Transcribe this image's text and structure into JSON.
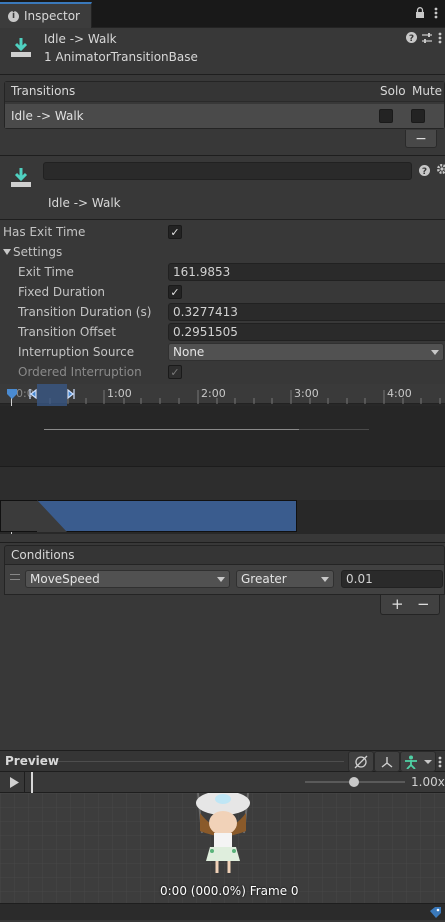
{
  "tab": {
    "label": "Inspector"
  },
  "header": {
    "title": "Idle -> Walk",
    "subtitle": "1 AnimatorTransitionBase"
  },
  "transitions_list": {
    "title": "Transitions",
    "col_solo": "Solo",
    "col_mute": "Mute",
    "rows": [
      {
        "label": "Idle -> Walk"
      }
    ],
    "remove_label": "−"
  },
  "transition": {
    "name_value": "",
    "label": "Idle -> Walk"
  },
  "props": {
    "has_exit_time": "Has Exit Time",
    "settings": "Settings",
    "exit_time": {
      "label": "Exit Time",
      "value": "161.9853"
    },
    "fixed_duration": "Fixed Duration",
    "transition_duration": {
      "label": "Transition Duration (s)",
      "value": "0.3277413"
    },
    "transition_offset": {
      "label": "Transition Offset",
      "value": "0.2951505"
    },
    "interruption_source": {
      "label": "Interruption Source",
      "value": "None"
    },
    "ordered_interruption": "Ordered Interruption"
  },
  "timeline": {
    "ticks": [
      "1:00",
      "2:00",
      "3:00",
      "4:00"
    ],
    "start_label": "0:0"
  },
  "conditions": {
    "title": "Conditions",
    "row": {
      "parameter": "MoveSpeed",
      "mode": "Greater",
      "threshold": "0.01"
    },
    "add_label": "+",
    "remove_label": "−"
  },
  "preview": {
    "title": "Preview",
    "speed": "1.00x",
    "frame_info": "0:00 (000.0%) Frame 0"
  },
  "colors": {
    "accent": "#3a79bb",
    "blend_region": "#3a5a8a",
    "background": "#383838"
  }
}
